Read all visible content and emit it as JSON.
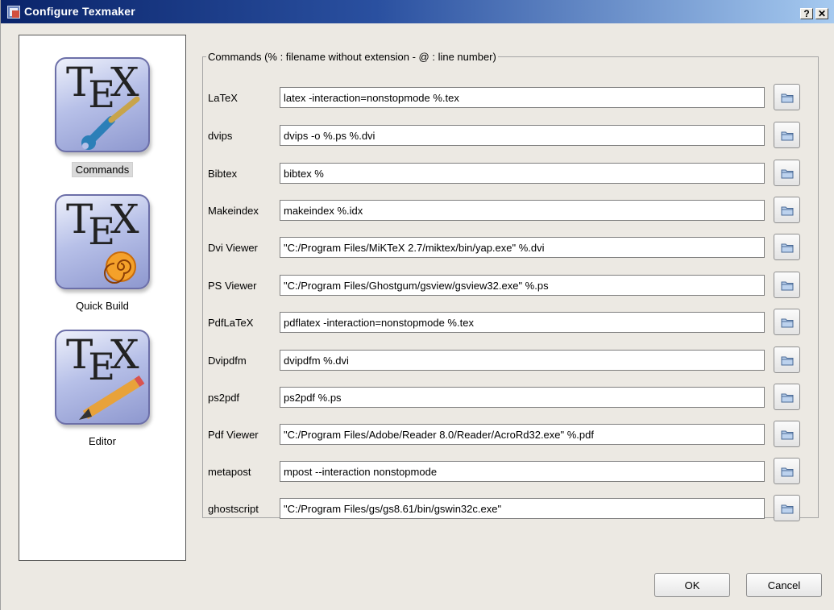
{
  "window": {
    "title": "Configure Texmaker",
    "help_label": "?",
    "close_label": "✕"
  },
  "sidebar": {
    "items": [
      {
        "label": "Commands",
        "icon": "tex-wrench-icon",
        "selected": true
      },
      {
        "label": "Quick Build",
        "icon": "tex-spiral-icon",
        "selected": false
      },
      {
        "label": "Editor",
        "icon": "tex-pencil-icon",
        "selected": false
      }
    ]
  },
  "commands": {
    "group_title": "Commands (% : filename without extension - @ : line number)",
    "rows": [
      {
        "label": "LaTeX",
        "value": "latex -interaction=nonstopmode %.tex"
      },
      {
        "label": "dvips",
        "value": "dvips -o %.ps %.dvi"
      },
      {
        "label": "Bibtex",
        "value": "bibtex %"
      },
      {
        "label": "Makeindex",
        "value": "makeindex %.idx"
      },
      {
        "label": "Dvi Viewer",
        "value": "\"C:/Program Files/MiKTeX 2.7/miktex/bin/yap.exe\" %.dvi"
      },
      {
        "label": "PS Viewer",
        "value": "\"C:/Program Files/Ghostgum/gsview/gsview32.exe\" %.ps"
      },
      {
        "label": "PdfLaTeX",
        "value": "pdflatex -interaction=nonstopmode %.tex"
      },
      {
        "label": "Dvipdfm",
        "value": "dvipdfm %.dvi"
      },
      {
        "label": "ps2pdf",
        "value": "ps2pdf %.ps"
      },
      {
        "label": "Pdf Viewer",
        "value": "\"C:/Program Files/Adobe/Reader 8.0/Reader/AcroRd32.exe\" %.pdf"
      },
      {
        "label": "metapost",
        "value": "mpost --interaction nonstopmode"
      },
      {
        "label": "ghostscript",
        "value": "\"C:/Program Files/gs/gs8.61/bin/gswin32c.exe\""
      }
    ]
  },
  "buttons": {
    "ok": "OK",
    "cancel": "Cancel"
  },
  "colors": {
    "titlebar_start": "#0a246a",
    "titlebar_end": "#a6caf0",
    "dialog_bg": "#ece9e3"
  }
}
